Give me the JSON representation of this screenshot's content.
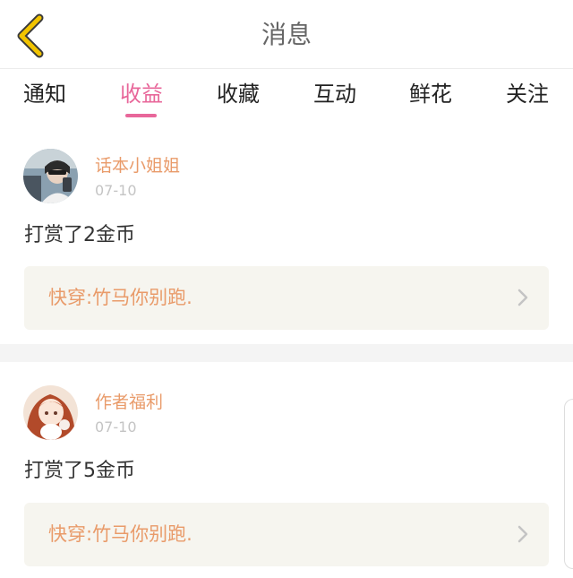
{
  "header": {
    "title": "消息",
    "back_icon": "chevron-left-icon",
    "accent": "#f2c400"
  },
  "tabs": [
    {
      "label": "通知",
      "active": false
    },
    {
      "label": "收益",
      "active": true
    },
    {
      "label": "收藏",
      "active": false
    },
    {
      "label": "互动",
      "active": false
    },
    {
      "label": "鲜花",
      "active": false
    },
    {
      "label": "关注",
      "active": false
    }
  ],
  "colors": {
    "active_tab": "#e8679a",
    "username": "#e99b6a",
    "book_box_bg": "#f6f5ef"
  },
  "messages": [
    {
      "username": "话本小姐姐",
      "date": "07-10",
      "text": "打赏了2金币",
      "book_title": "快穿:竹马你别跑.",
      "avatar_icon": "user-avatar-photo"
    },
    {
      "username": "作者福利",
      "date": "07-10",
      "text": "打赏了5金币",
      "book_title": "快穿:竹马你别跑.",
      "avatar_icon": "anime-girl-avatar"
    }
  ]
}
